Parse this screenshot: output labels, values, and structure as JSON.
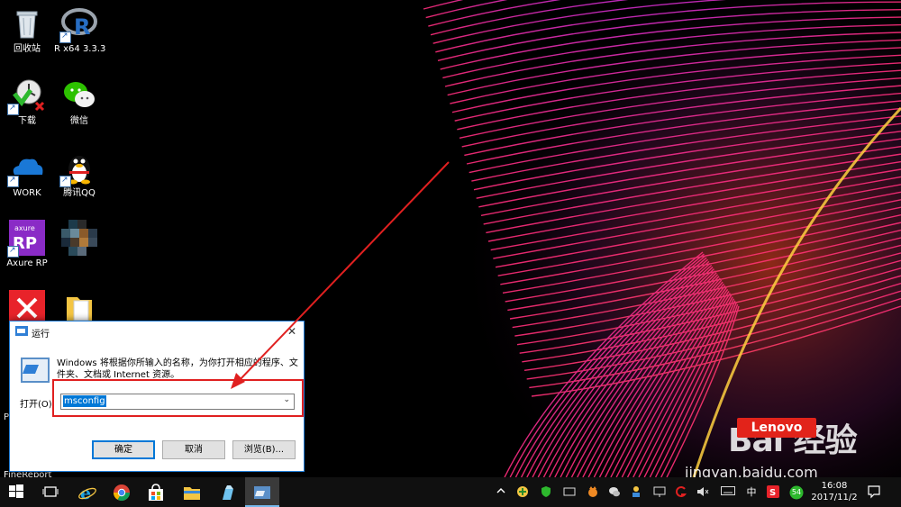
{
  "desktop": {
    "icons": [
      {
        "label": "回收站"
      },
      {
        "label": "R x64 3.3.3"
      },
      {
        "label": "下载"
      },
      {
        "label": "微信"
      },
      {
        "label": "WORK"
      },
      {
        "label": "腾讯QQ"
      },
      {
        "label": "Axure RP"
      },
      {
        "label": ""
      },
      {
        "label": ""
      },
      {
        "label": ""
      }
    ],
    "partial_labels": {
      "p": "P",
      "finereport": "FineReport"
    },
    "axure_badge": {
      "top": "axure",
      "main": "RP"
    }
  },
  "run_dialog": {
    "title": "运行",
    "close_glyph": "✕",
    "description": "Windows 将根据你所输入的名称，为你打开相应的程序、文件夹、文档或 Internet 资源。",
    "open_label": "打开(O):",
    "input_value": "msconfig",
    "ok_label": "确定",
    "cancel_label": "取消",
    "browse_label": "浏览(B)..."
  },
  "watermark": {
    "logo_text": "Bai 经验",
    "lenovo": "Lenovo",
    "url": "jingyan.baidu.com"
  },
  "taskbar": {
    "tray_lang": "中",
    "tray_badge": "54",
    "clock_time": "16:08",
    "clock_date": "2017/11/2"
  },
  "icons": {
    "start": "windows-logo-icon",
    "taskview": "task-view-icon",
    "ie": "internet-explorer-icon",
    "chrome": "chrome-icon",
    "store": "store-icon",
    "explorer": "file-explorer-icon",
    "pen": "pen-tool-icon",
    "run": "run-icon"
  },
  "colors": {
    "accent": "#0078d7",
    "highlight": "#e02020",
    "taskbar": "#101010"
  }
}
